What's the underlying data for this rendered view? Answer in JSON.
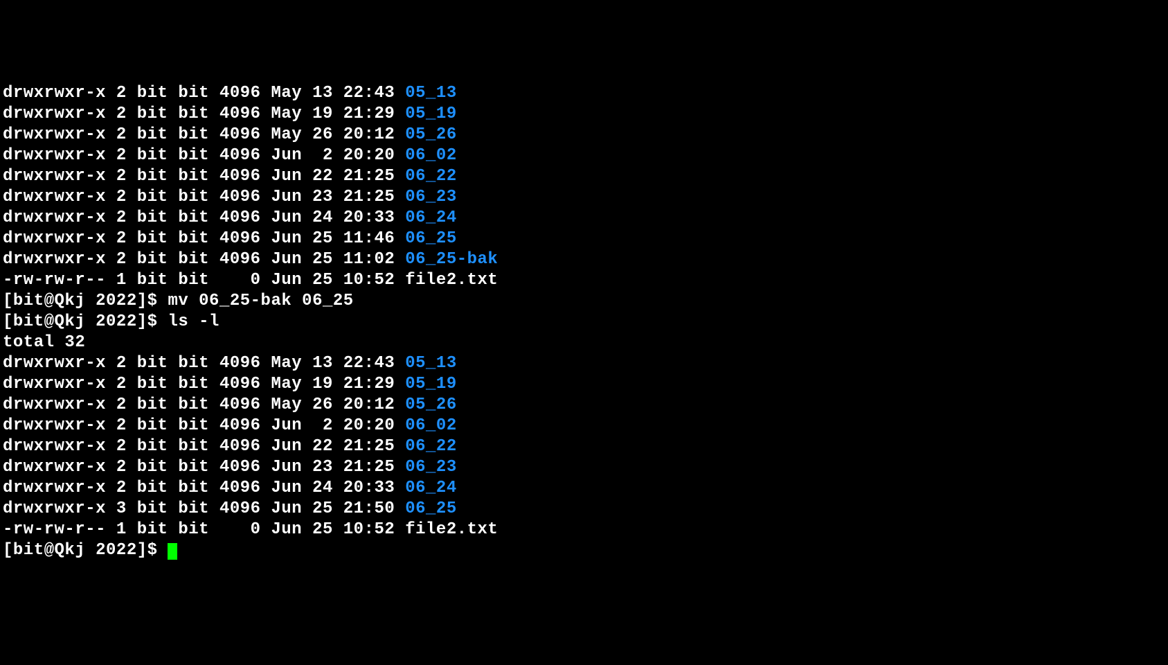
{
  "listing1": [
    {
      "perm": "drwxrwxr-x",
      "links": "2",
      "owner": "bit",
      "group": "bit",
      "size": "4096",
      "date": "May 13 22:43",
      "name": "05_13",
      "dir": true
    },
    {
      "perm": "drwxrwxr-x",
      "links": "2",
      "owner": "bit",
      "group": "bit",
      "size": "4096",
      "date": "May 19 21:29",
      "name": "05_19",
      "dir": true
    },
    {
      "perm": "drwxrwxr-x",
      "links": "2",
      "owner": "bit",
      "group": "bit",
      "size": "4096",
      "date": "May 26 20:12",
      "name": "05_26",
      "dir": true
    },
    {
      "perm": "drwxrwxr-x",
      "links": "2",
      "owner": "bit",
      "group": "bit",
      "size": "4096",
      "date": "Jun  2 20:20",
      "name": "06_02",
      "dir": true
    },
    {
      "perm": "drwxrwxr-x",
      "links": "2",
      "owner": "bit",
      "group": "bit",
      "size": "4096",
      "date": "Jun 22 21:25",
      "name": "06_22",
      "dir": true
    },
    {
      "perm": "drwxrwxr-x",
      "links": "2",
      "owner": "bit",
      "group": "bit",
      "size": "4096",
      "date": "Jun 23 21:25",
      "name": "06_23",
      "dir": true
    },
    {
      "perm": "drwxrwxr-x",
      "links": "2",
      "owner": "bit",
      "group": "bit",
      "size": "4096",
      "date": "Jun 24 20:33",
      "name": "06_24",
      "dir": true
    },
    {
      "perm": "drwxrwxr-x",
      "links": "2",
      "owner": "bit",
      "group": "bit",
      "size": "4096",
      "date": "Jun 25 11:46",
      "name": "06_25",
      "dir": true
    },
    {
      "perm": "drwxrwxr-x",
      "links": "2",
      "owner": "bit",
      "group": "bit",
      "size": "4096",
      "date": "Jun 25 11:02",
      "name": "06_25-bak",
      "dir": true
    },
    {
      "perm": "-rw-rw-r--",
      "links": "1",
      "owner": "bit",
      "group": "bit",
      "size": "   0",
      "date": "Jun 25 10:52",
      "name": "file2.txt",
      "dir": false
    }
  ],
  "prompt1": {
    "prefix": "[bit@Qkj 2022]$ ",
    "cmd": "mv 06_25-bak 06_25"
  },
  "prompt2": {
    "prefix": "[bit@Qkj 2022]$ ",
    "cmd": "ls -l"
  },
  "total": "total 32",
  "listing2": [
    {
      "perm": "drwxrwxr-x",
      "links": "2",
      "owner": "bit",
      "group": "bit",
      "size": "4096",
      "date": "May 13 22:43",
      "name": "05_13",
      "dir": true
    },
    {
      "perm": "drwxrwxr-x",
      "links": "2",
      "owner": "bit",
      "group": "bit",
      "size": "4096",
      "date": "May 19 21:29",
      "name": "05_19",
      "dir": true
    },
    {
      "perm": "drwxrwxr-x",
      "links": "2",
      "owner": "bit",
      "group": "bit",
      "size": "4096",
      "date": "May 26 20:12",
      "name": "05_26",
      "dir": true
    },
    {
      "perm": "drwxrwxr-x",
      "links": "2",
      "owner": "bit",
      "group": "bit",
      "size": "4096",
      "date": "Jun  2 20:20",
      "name": "06_02",
      "dir": true
    },
    {
      "perm": "drwxrwxr-x",
      "links": "2",
      "owner": "bit",
      "group": "bit",
      "size": "4096",
      "date": "Jun 22 21:25",
      "name": "06_22",
      "dir": true
    },
    {
      "perm": "drwxrwxr-x",
      "links": "2",
      "owner": "bit",
      "group": "bit",
      "size": "4096",
      "date": "Jun 23 21:25",
      "name": "06_23",
      "dir": true
    },
    {
      "perm": "drwxrwxr-x",
      "links": "2",
      "owner": "bit",
      "group": "bit",
      "size": "4096",
      "date": "Jun 24 20:33",
      "name": "06_24",
      "dir": true
    },
    {
      "perm": "drwxrwxr-x",
      "links": "3",
      "owner": "bit",
      "group": "bit",
      "size": "4096",
      "date": "Jun 25 21:50",
      "name": "06_25",
      "dir": true
    },
    {
      "perm": "-rw-rw-r--",
      "links": "1",
      "owner": "bit",
      "group": "bit",
      "size": "   0",
      "date": "Jun 25 10:52",
      "name": "file2.txt",
      "dir": false
    }
  ],
  "prompt3": {
    "prefix": "[bit@Qkj 2022]$ "
  }
}
